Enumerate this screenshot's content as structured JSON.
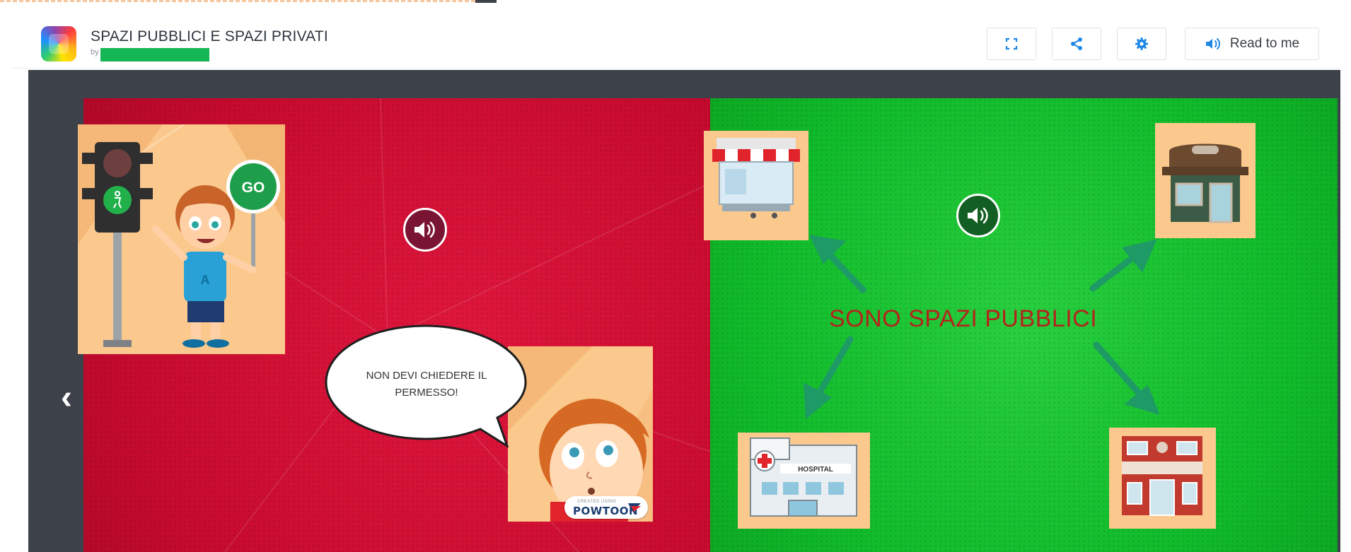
{
  "app": {
    "title": "SPAZI PUBBLICI E SPAZI PRIVATI",
    "by_label": "by"
  },
  "toolbar": {
    "fullscreen_icon": "fullscreen-icon",
    "share_icon": "share-icon",
    "settings_icon": "gear-icon",
    "read_icon": "speaker-icon",
    "read_label": "Read to me"
  },
  "book": {
    "left_page": {
      "speech_bubble": "NON DEVI CHIEDERE IL PERMESSO!",
      "go_sign": "GO",
      "shirt_letter": "A",
      "watermark_small": "CREATED USING",
      "watermark": "POWTOON"
    },
    "right_page": {
      "caption": "SONO SPAZI PUBBLICI",
      "hospital_sign": "HOSPITAL"
    }
  },
  "colors": {
    "accent": "#1e88e5",
    "left_page": "#d0103a",
    "right_page": "#17c232",
    "caption": "#b3241c",
    "stage": "#3c414a"
  }
}
